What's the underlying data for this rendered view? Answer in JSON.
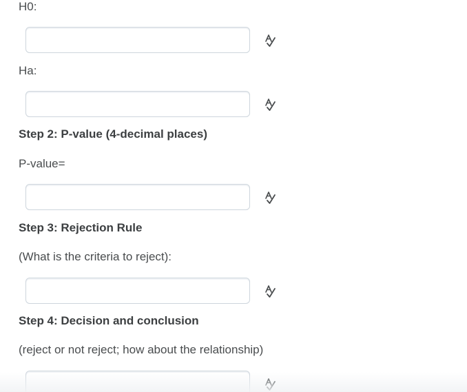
{
  "hypotheses": {
    "h0_label": "H0:",
    "ha_label": "Ha:"
  },
  "step2": {
    "title": "Step 2: P-value (4-decimal places)",
    "pvalue_label": "P-value="
  },
  "step3": {
    "title": "Step 3: Rejection Rule",
    "prompt": "(What is the criteria to reject):"
  },
  "step4": {
    "title": "Step 4: Decision and conclusion",
    "prompt": "(reject or not reject; how about the relationship)"
  },
  "fields": {
    "h0_value": "",
    "ha_value": "",
    "pvalue_value": "",
    "rejection_value": "",
    "decision_value": ""
  },
  "icons": {
    "answer_format": "spell-check-icon"
  },
  "colors": {
    "text": "#494c4e",
    "heading": "#3c3f41",
    "field_border": "#cdd5dc"
  }
}
